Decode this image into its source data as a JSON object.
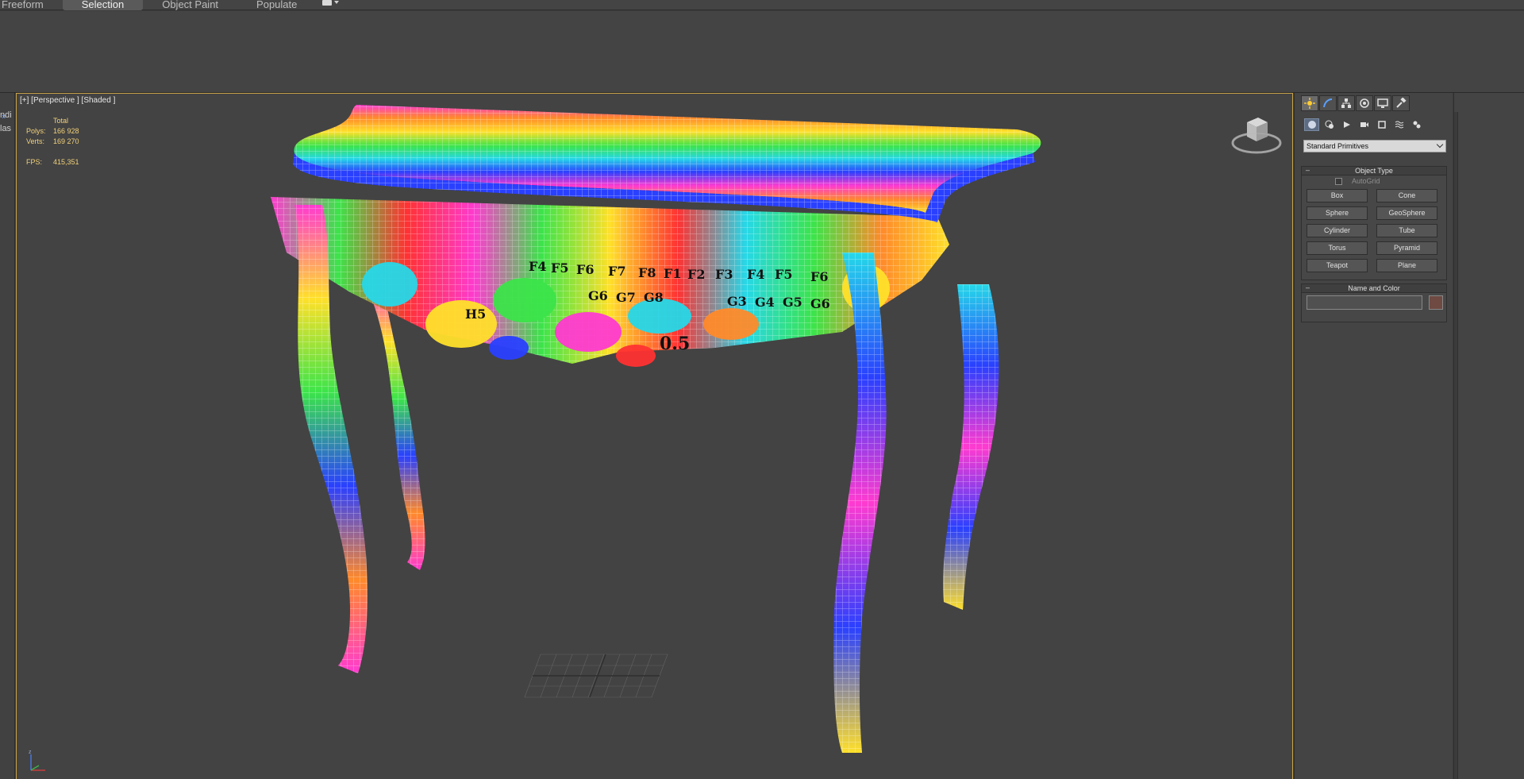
{
  "ribbon": {
    "tabs": [
      {
        "label": "Freeform",
        "active": false
      },
      {
        "label": "Selection",
        "active": true
      },
      {
        "label": "Object Paint",
        "active": false
      },
      {
        "label": "Populate",
        "active": false
      }
    ],
    "extra_icon": "camera-dropdown-icon"
  },
  "left_strip": {
    "chevron": "»",
    "fragments": [
      "ndi",
      "las"
    ]
  },
  "viewport": {
    "label": "[+] [Perspective ] [Shaded ]",
    "stats": {
      "header": "Total",
      "polys_label": "Polys:",
      "polys_value": "166 928",
      "verts_label": "Verts:",
      "verts_value": "169 270",
      "fps_label": "FPS:",
      "fps_value": "415,351"
    },
    "viewcube_label": "viewcube",
    "axis": {
      "z": "z",
      "x": "x"
    },
    "border_color": "#c8a24a",
    "stats_color": "#f2d17a"
  },
  "command_panel": {
    "tabs": [
      "create-icon",
      "modify-icon",
      "hierarchy-icon",
      "motion-icon",
      "display-icon",
      "utilities-icon"
    ],
    "subtabs": [
      "geometry-icon",
      "shapes-icon",
      "lights-icon",
      "cameras-icon",
      "helpers-icon",
      "spacewarps-icon",
      "systems-icon"
    ],
    "category": "Standard Primitives",
    "object_type": {
      "title": "Object Type",
      "autogrid": "AutoGrid",
      "buttons": [
        "Box",
        "Cone",
        "Sphere",
        "GeoSphere",
        "Cylinder",
        "Tube",
        "Torus",
        "Pyramid",
        "Teapot",
        "Plane"
      ]
    },
    "name_and_color": {
      "title": "Name and Color",
      "name_value": "",
      "color": "#6e4a43"
    }
  }
}
